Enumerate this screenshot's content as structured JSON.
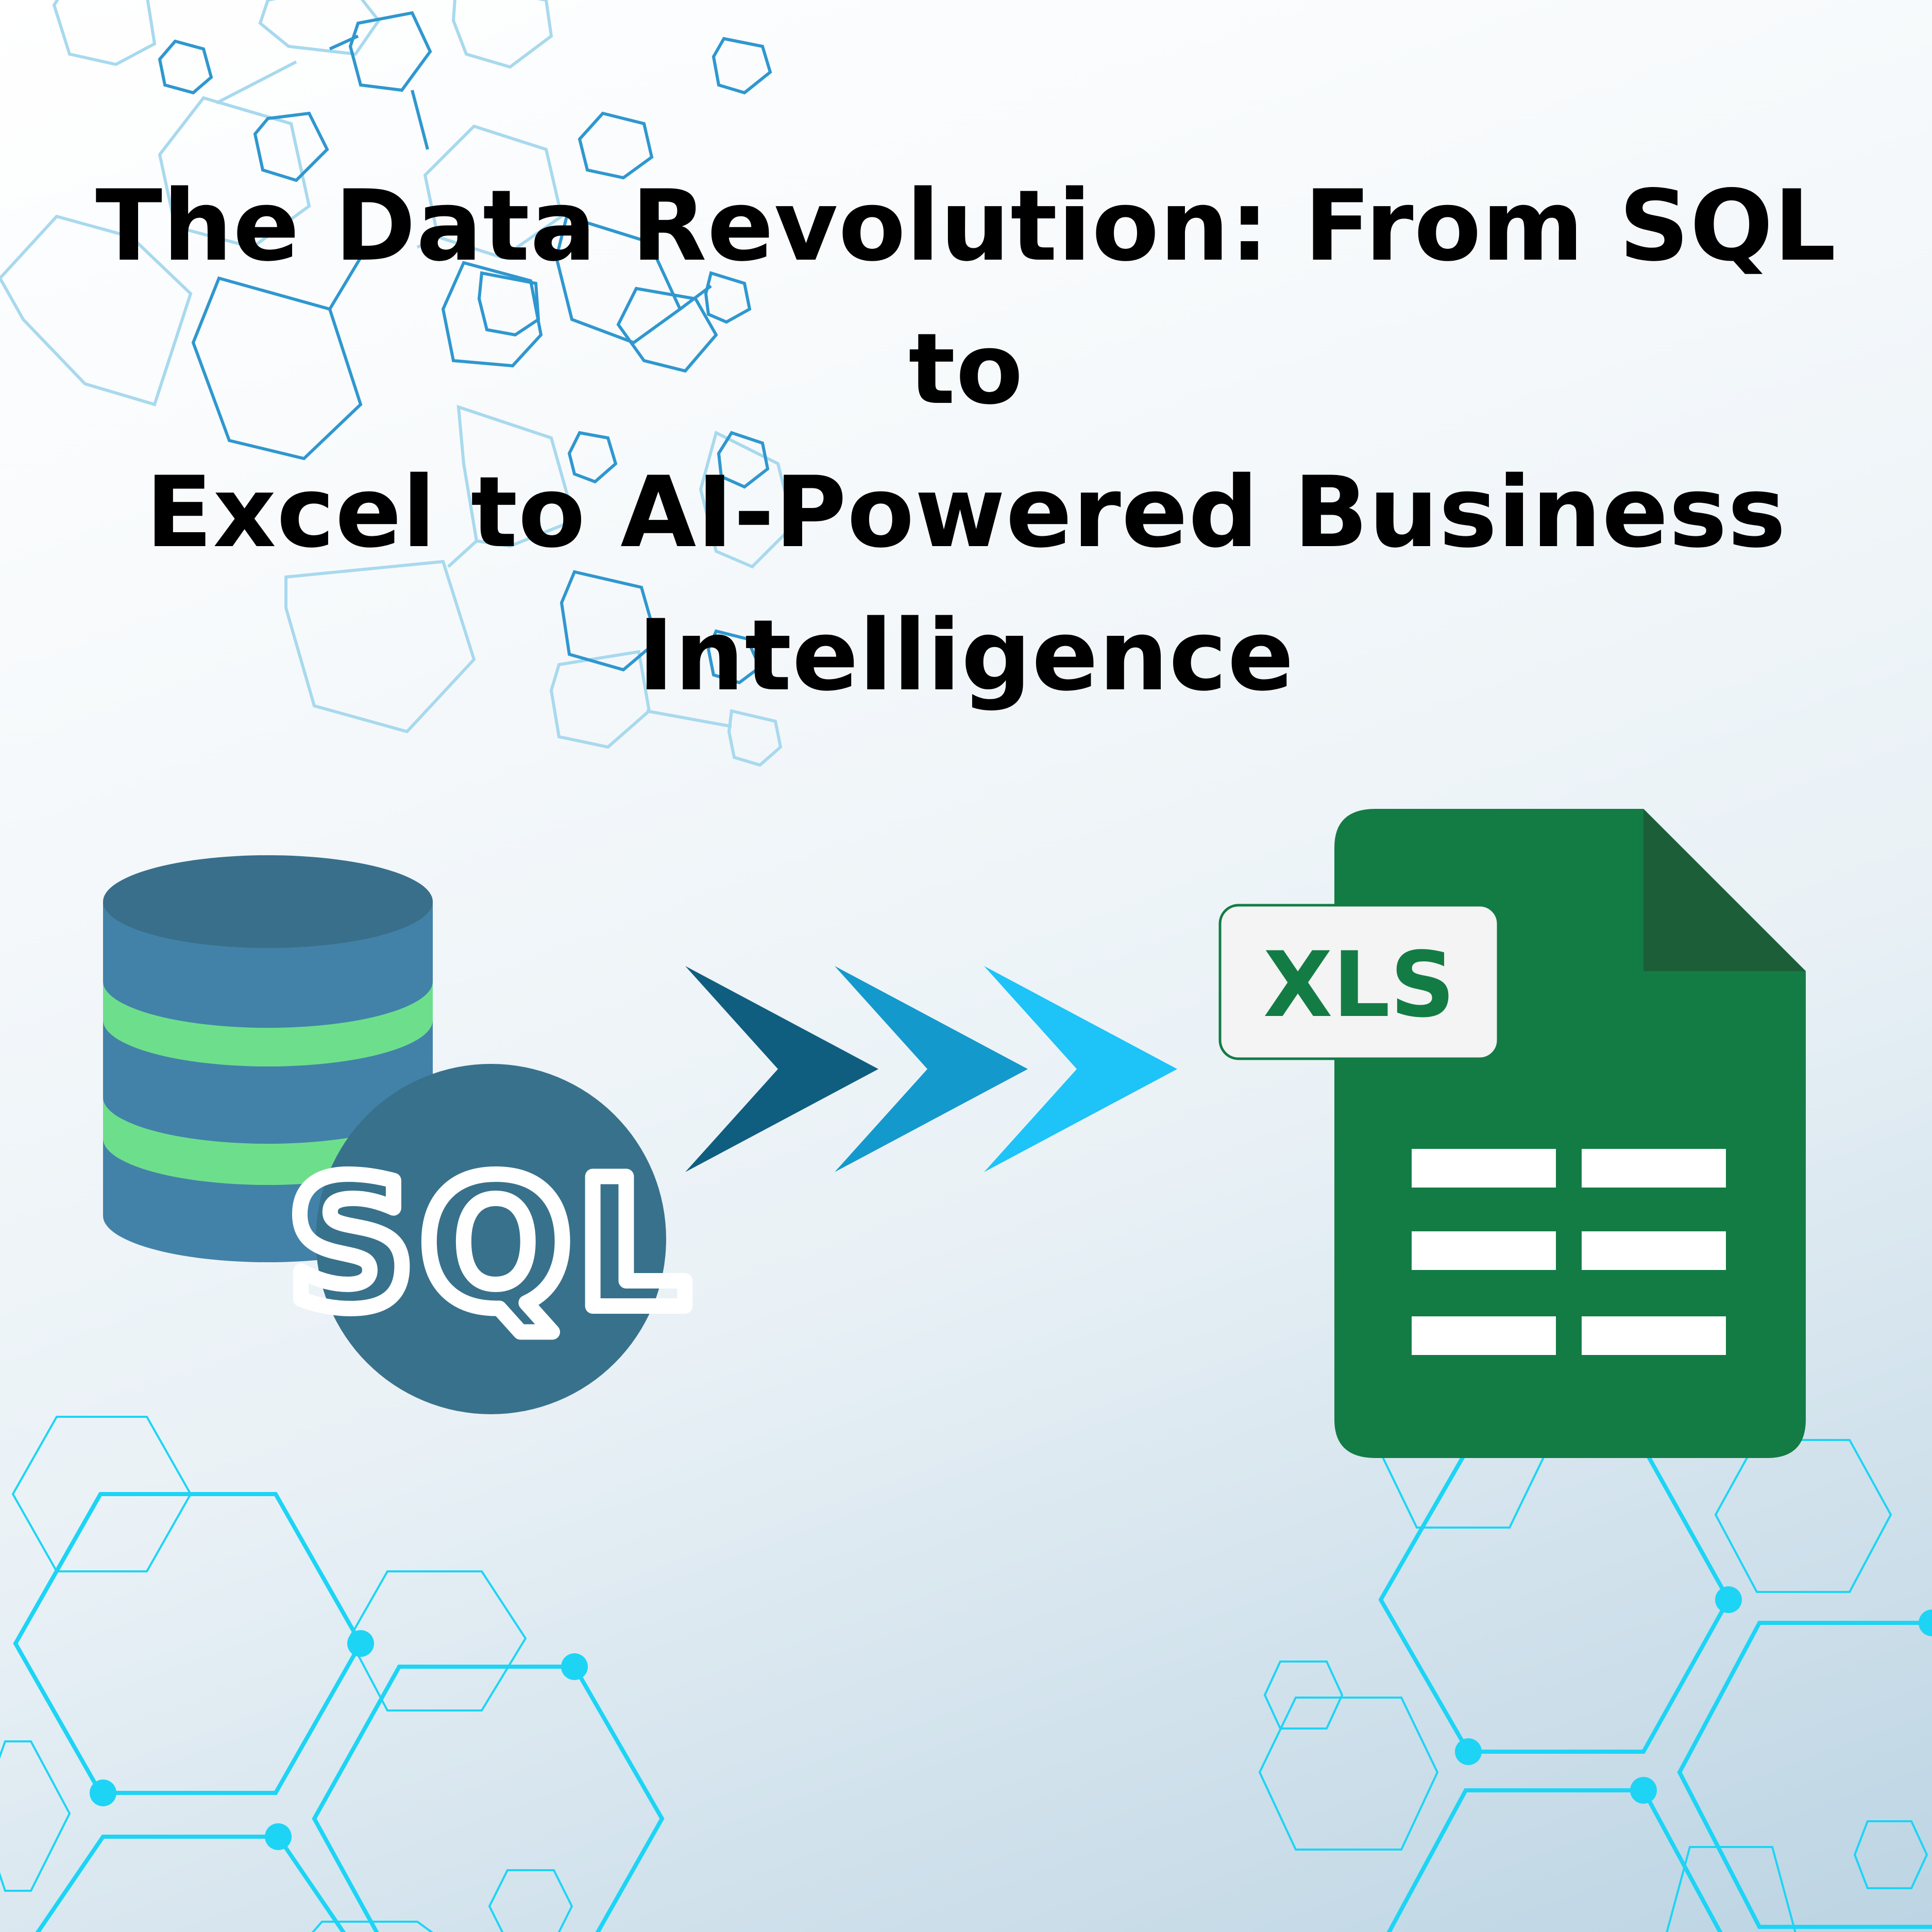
{
  "title": {
    "line1": "The Data Revolution: From SQL to",
    "line2": "Excel to AI-Powered Business",
    "line3": "Intelligence"
  },
  "database_icon": {
    "badge_text": "SQL",
    "colors": {
      "body": "#4282a8",
      "top": "#396f8a",
      "stripe": "#6ddf8c",
      "badge": "#38718c",
      "badge_text": "#ffffff"
    }
  },
  "arrows": {
    "colors": [
      "#0f5e80",
      "#1499cc",
      "#1ec3f7"
    ]
  },
  "spreadsheet_icon": {
    "label_text": "XLS",
    "colors": {
      "body": "#137c45",
      "fold": "#1b5e38",
      "label_bg": "#f3f4f3",
      "label_text": "#137c45",
      "rows": "#ffffff"
    }
  },
  "decoration": {
    "hex_color_light": "#a8d9ee",
    "hex_color_mid": "#2f97cf",
    "hex_color_bright": "#1dd4f5"
  }
}
